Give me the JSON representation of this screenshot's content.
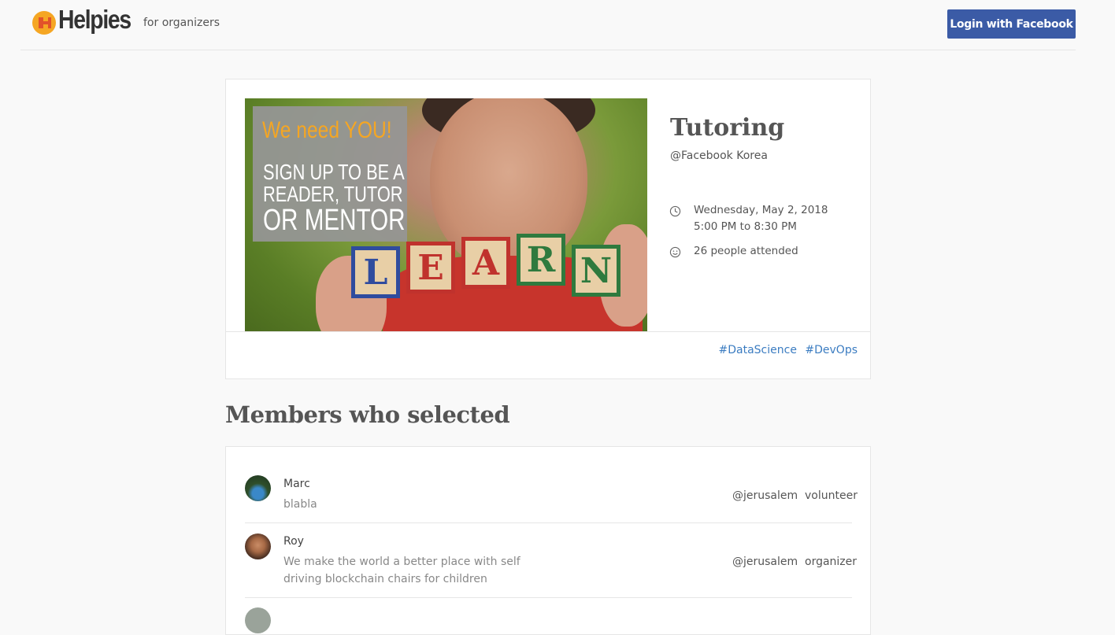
{
  "header": {
    "logo_text": "Helpies",
    "logo_sub": "for organizers",
    "login_label": "Login with Facebook"
  },
  "event": {
    "image_text": {
      "line1": "We need YOU!",
      "line2": "SIGN UP TO BE A",
      "line3": "READER, TUTOR",
      "line4": "OR MENTOR",
      "blocks": [
        "L",
        "E",
        "A",
        "R",
        "N"
      ]
    },
    "title": "Tutoring",
    "host": "@Facebook Korea",
    "date": "Wednesday, May 2, 2018",
    "time": "5:00 PM to 8:30 PM",
    "attendance": "26 people attended",
    "tags": [
      "#DataScience",
      "#DevOps"
    ]
  },
  "members_section": {
    "title": "Members who selected",
    "members": [
      {
        "name": "Marc",
        "description": "blabla",
        "location": "@jerusalem",
        "role": "volunteer"
      },
      {
        "name": "Roy",
        "description": "We make the world a better place with self driving blockchain chairs for children",
        "location": "@jerusalem",
        "role": "organizer"
      }
    ]
  },
  "colors": {
    "brand_orange": "#f5a623",
    "facebook_blue": "#3b5ba6",
    "tag_link": "#3b7cc1"
  }
}
